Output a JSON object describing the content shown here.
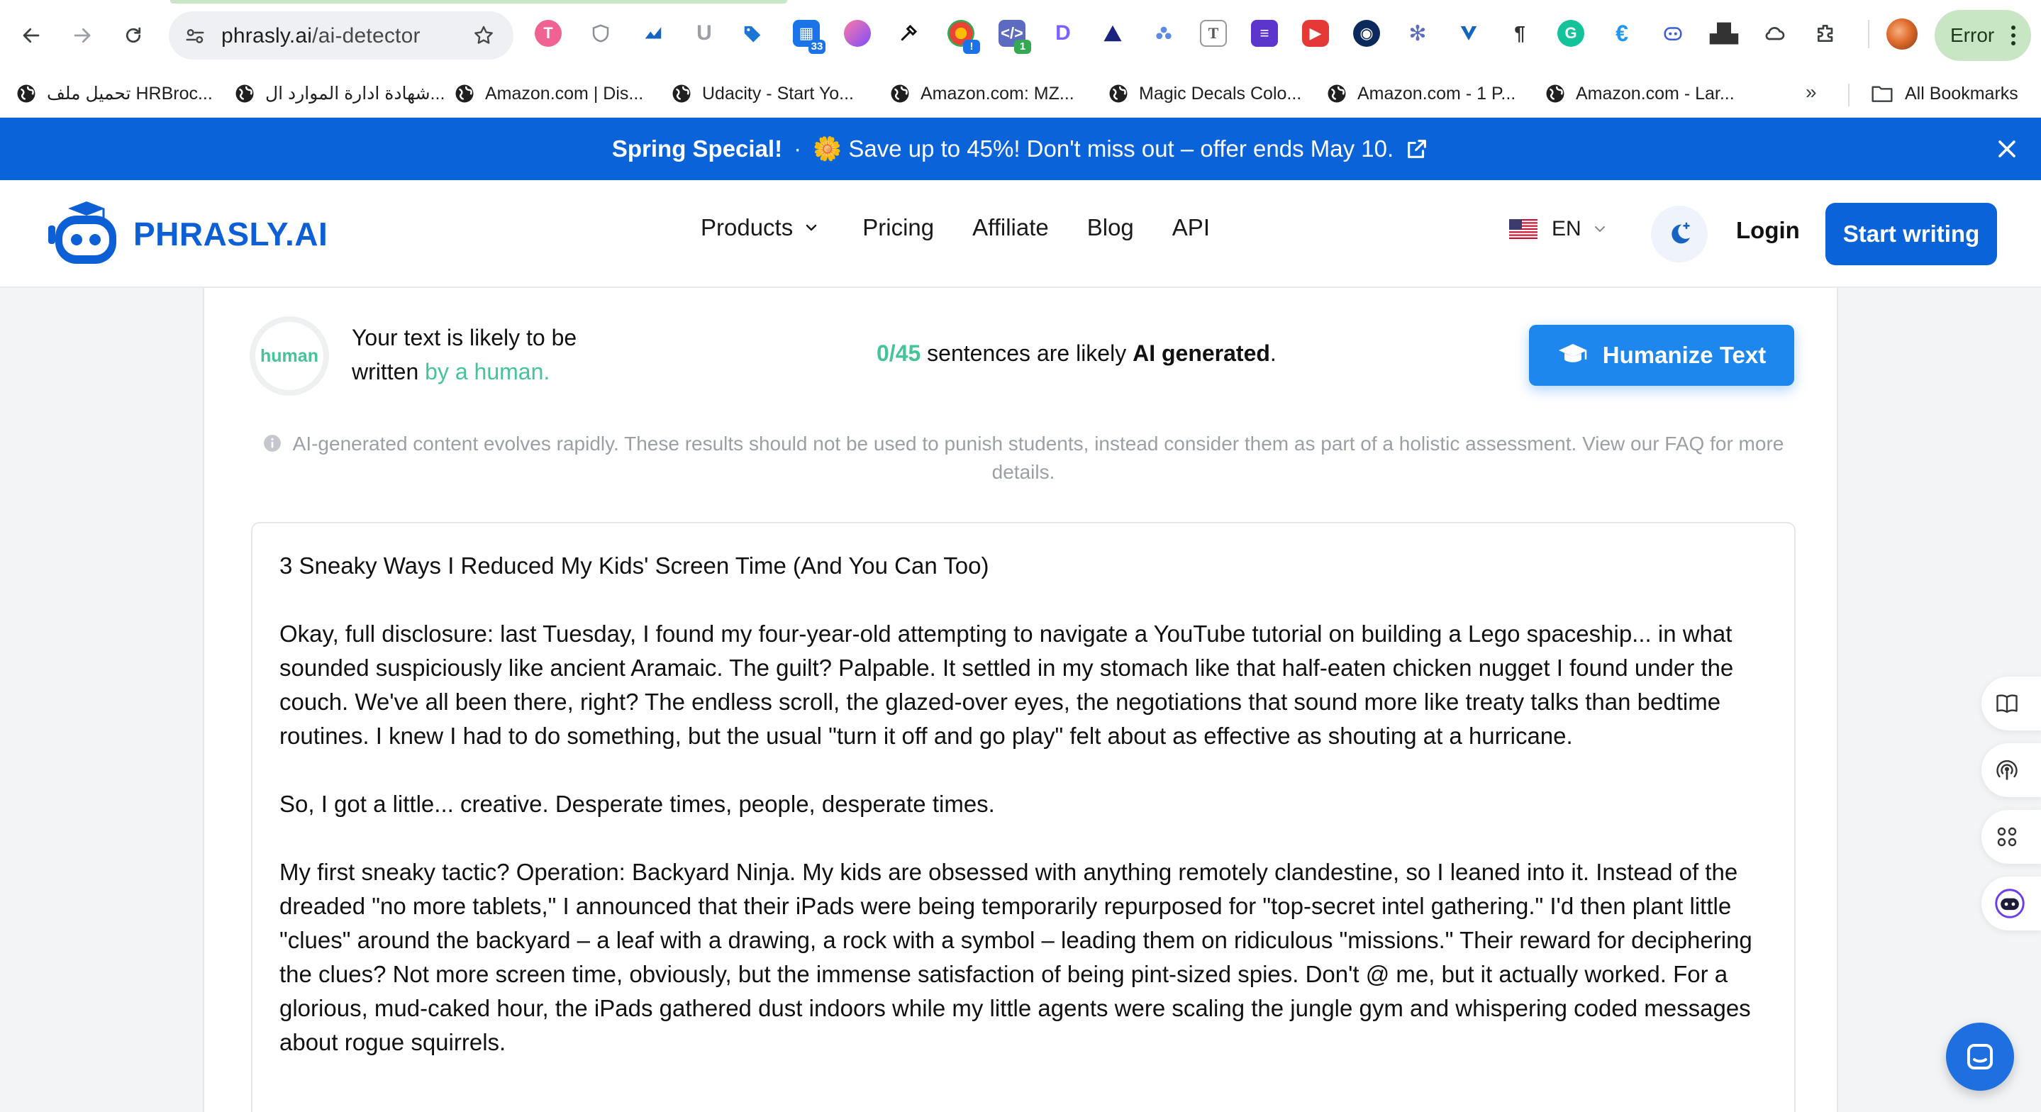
{
  "browser": {
    "url_domain": "phrasly.ai",
    "url_path": "/ai-detector",
    "extensions_badges": {
      "calendar": "33",
      "alert": "!",
      "code": "1"
    },
    "profile_button": "Error",
    "bookmarks": [
      "تحميل ملف HRBroc...",
      "شهادة ادارة الموارد ال...",
      "Amazon.com | Dis...",
      "Udacity - Start Yo...",
      "Amazon.com: MZ...",
      "Magic Decals Colo...",
      "Amazon.com - 1 P...",
      "Amazon.com - Lar..."
    ],
    "more_bookmarks": "»",
    "all_bookmarks": "All Bookmarks"
  },
  "promo": {
    "bold": "Spring Special!",
    "separator": "·",
    "text": "🌼 Save up to 45%! Don't miss out – offer ends May 10."
  },
  "header": {
    "logo": "PHRASLY.AI",
    "nav": [
      "Products",
      "Pricing",
      "Affiliate",
      "Blog",
      "API"
    ],
    "language": "EN",
    "login": "Login",
    "cta": "Start writing"
  },
  "result": {
    "gauge_label": "human",
    "verdict_line1": "Your text is likely to be",
    "verdict_line2_prefix": "written",
    "verdict_line2_highlight": "by a human.",
    "sentences_count": "0/45",
    "sentences_text": "sentences are likely",
    "sentences_bold": "AI generated",
    "sentences_end": ".",
    "humanize_button": "Humanize Text",
    "disclaimer": "AI-generated content evolves rapidly. These results should not be used to punish students, instead consider them as part of a holistic assessment. View our FAQ for more details."
  },
  "document": {
    "title": "3 Sneaky Ways I Reduced My Kids' Screen Time (And You Can Too)",
    "paragraphs": [
      "Okay, full disclosure: last Tuesday, I found my four-year-old attempting to navigate a YouTube tutorial on building a Lego spaceship... in what sounded suspiciously like ancient Aramaic. The guilt? Palpable. It settled in my stomach like that half-eaten chicken nugget I found under the couch. We've all been there, right? The endless scroll, the glazed-over eyes, the negotiations that sound more like treaty talks than bedtime routines. I knew I had to do something, but the usual \"turn it off and go play\" felt about as effective as shouting at a hurricane.",
      "So, I got a little... creative. Desperate times, people, desperate times.",
      "My first sneaky tactic? Operation: Backyard Ninja. My kids are obsessed with anything remotely clandestine, so I leaned into it. Instead of the dreaded \"no more tablets,\" I announced that their iPads were being temporarily repurposed for \"top-secret intel gathering.\" I'd then plant little \"clues\" around the backyard – a leaf with a drawing, a rock with a symbol – leading them on ridiculous \"missions.\" Their reward for deciphering the clues? Not more screen time, obviously, but the immense satisfaction of being pint-sized spies. Don't @ me, but it actually worked. For a glorious, mud-caked hour, the iPads gathered dust indoors while my little agents were scaling the jungle gym and whispering coded messages about rogue squirrels."
    ]
  },
  "colors": {
    "brand_blue": "#0a63d9",
    "button_blue": "#1e87ee",
    "human_green": "#45c39a",
    "chrome_pill_green": "#c8e6c4"
  }
}
